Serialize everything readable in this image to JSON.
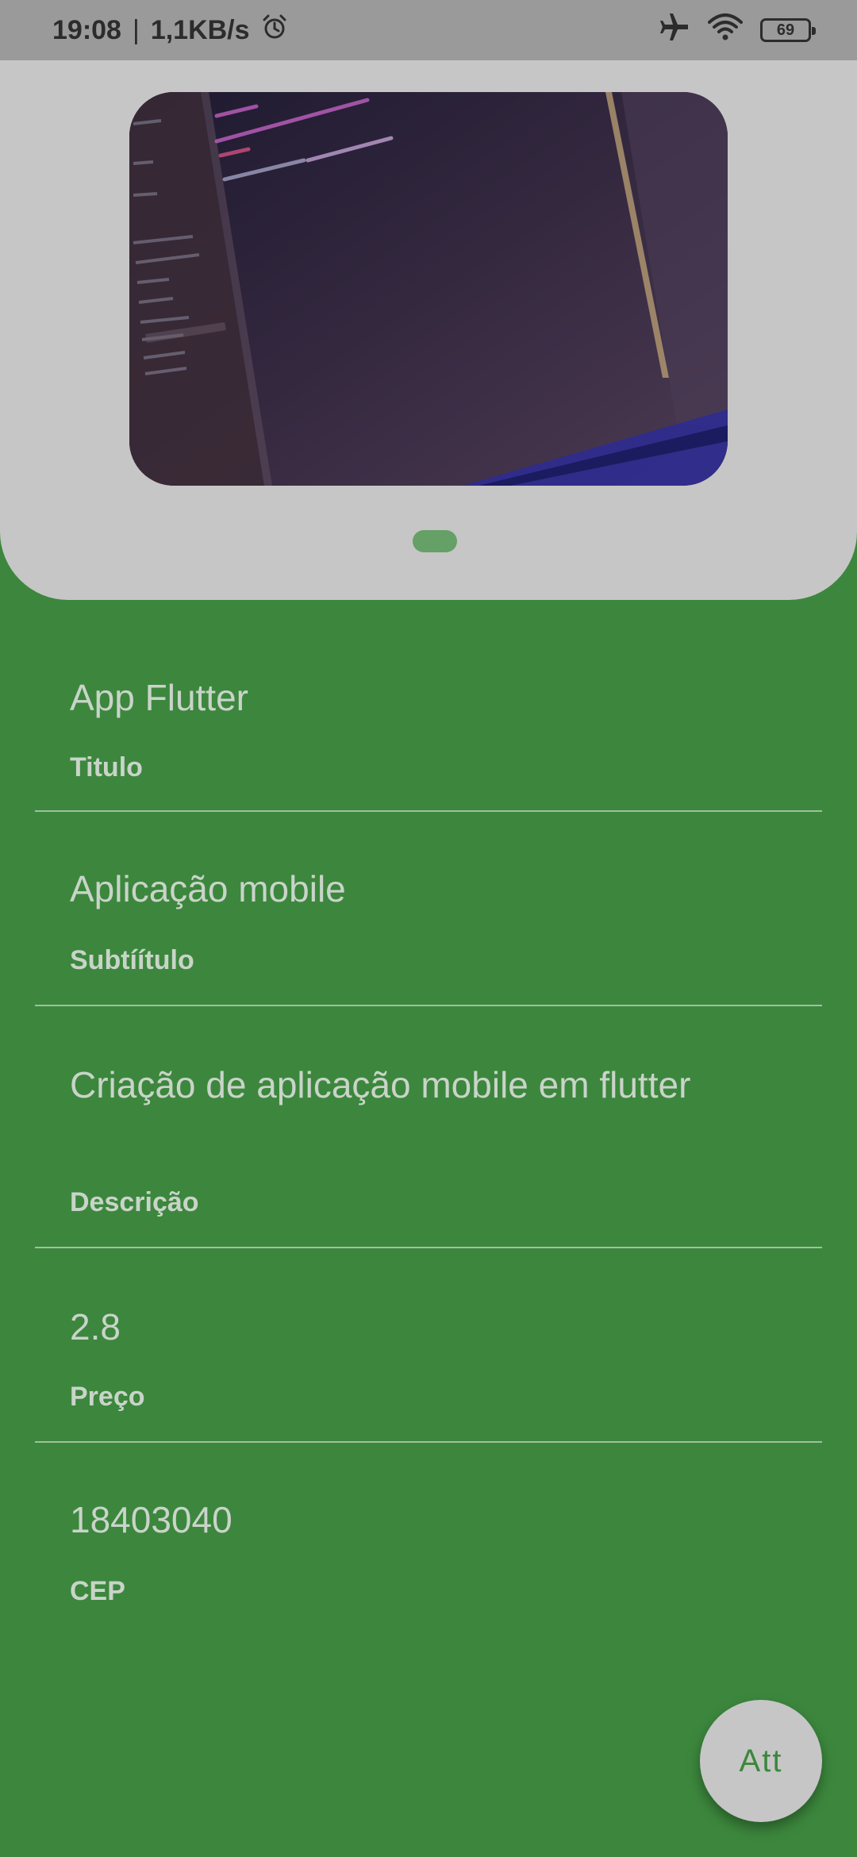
{
  "status_bar": {
    "time": "19:08",
    "separator": "|",
    "network_speed": "1,1KB/s",
    "battery_level": "69",
    "icons": [
      "alarm-icon",
      "airplane-mode-icon",
      "wifi-icon",
      "battery-icon"
    ]
  },
  "carousel": {
    "page_count": 1,
    "active_page": 0,
    "indicator_color": "#65A067"
  },
  "fields": [
    {
      "value": "App Flutter",
      "label": "Titulo"
    },
    {
      "value": "Aplicação mobile",
      "label": "Subtíítulo"
    },
    {
      "value": "Criação de aplicação mobile em flutter",
      "label": "Descrição"
    },
    {
      "value": "2.8",
      "label": "Preço"
    },
    {
      "value": "18403040",
      "label": "CEP"
    }
  ],
  "fab": {
    "label": "Att"
  },
  "colors": {
    "background": "#3C873D",
    "card": "#C6C6C6",
    "status_bar": "#9A9A9A",
    "text": "#C9D4C9"
  }
}
